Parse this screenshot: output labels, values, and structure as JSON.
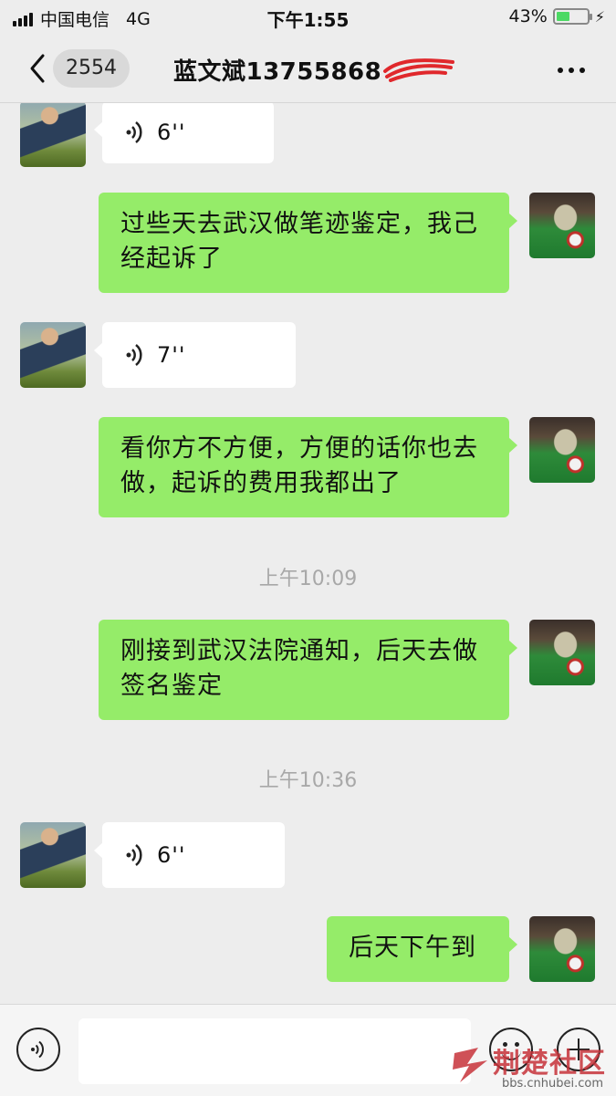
{
  "status_bar": {
    "carrier": "中国电信",
    "network": "4G",
    "time": "下午1:55",
    "battery_percent": "43%",
    "battery_level": 0.43
  },
  "nav": {
    "back_icon": "chevron-left-icon",
    "unread_count": "2554",
    "title": "蓝文斌13755868",
    "more_icon": "more-dots-icon"
  },
  "messages": [
    {
      "side": "left",
      "type": "voice",
      "duration": "6''"
    },
    {
      "side": "right",
      "type": "text",
      "text": "过些天去武汉做笔迹鉴定，我己经起诉了"
    },
    {
      "side": "left",
      "type": "voice",
      "duration": "7''"
    },
    {
      "side": "right",
      "type": "text",
      "text": "看你方不方便，方便的话你也去做，起诉的费用我都出了"
    },
    {
      "type": "timestamp",
      "text": "上午10:09"
    },
    {
      "side": "right",
      "type": "text",
      "text": "刚接到武汉法院通知，后天去做签名鉴定"
    },
    {
      "type": "timestamp",
      "text": "上午10:36"
    },
    {
      "side": "left",
      "type": "voice",
      "duration": "6''"
    },
    {
      "side": "right",
      "type": "text",
      "text": "后天下午到"
    }
  ],
  "input_bar": {
    "voice_icon": "voice-input-icon",
    "emoji_icon": "emoji-icon",
    "plus_icon": "plus-icon"
  },
  "watermark": {
    "name": "荆楚社区",
    "url": "bbs.cnhubei.com"
  },
  "colors": {
    "background": "#ededed",
    "outgoing_bubble": "#95ec69",
    "incoming_bubble": "#ffffff",
    "timestamp_text": "#a8a8a8"
  }
}
